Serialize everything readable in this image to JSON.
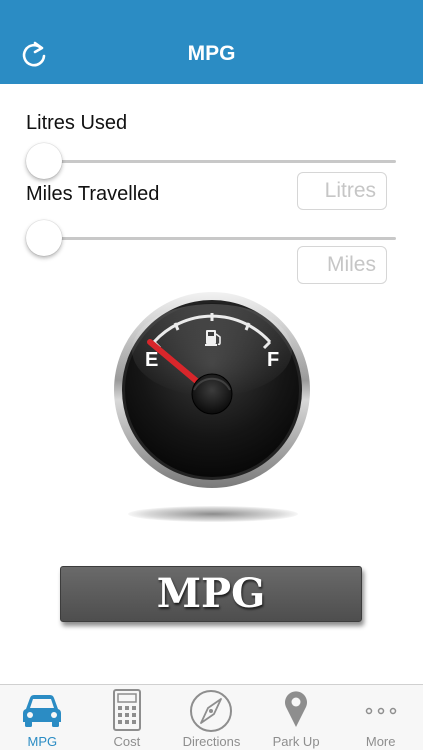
{
  "header": {
    "title": "MPG",
    "refresh_icon": "refresh-icon"
  },
  "form": {
    "litres_label": "Litres Used",
    "miles_label": "Miles Travelled",
    "litres_slider_value": 0,
    "miles_slider_value": 0,
    "litres_placeholder": "Litres",
    "miles_placeholder": "Miles"
  },
  "gauge": {
    "empty_label": "E",
    "full_label": "F",
    "fuel_icon": "fuel-pump-icon",
    "needle_position": 0
  },
  "result_button": {
    "label": "MPG"
  },
  "tabbar": {
    "tabs": [
      {
        "label": "MPG",
        "icon": "car-icon",
        "active": true
      },
      {
        "label": "Cost",
        "icon": "calculator-icon",
        "active": false
      },
      {
        "label": "Directions",
        "icon": "compass-icon",
        "active": false
      },
      {
        "label": "Park Up",
        "icon": "map-pin-icon",
        "active": false
      },
      {
        "label": "More",
        "icon": "more-dots-icon",
        "active": false
      }
    ]
  },
  "colors": {
    "accent": "#2b8cc4",
    "needle": "#d9262b",
    "inactive_tab": "#8e8e8e"
  }
}
